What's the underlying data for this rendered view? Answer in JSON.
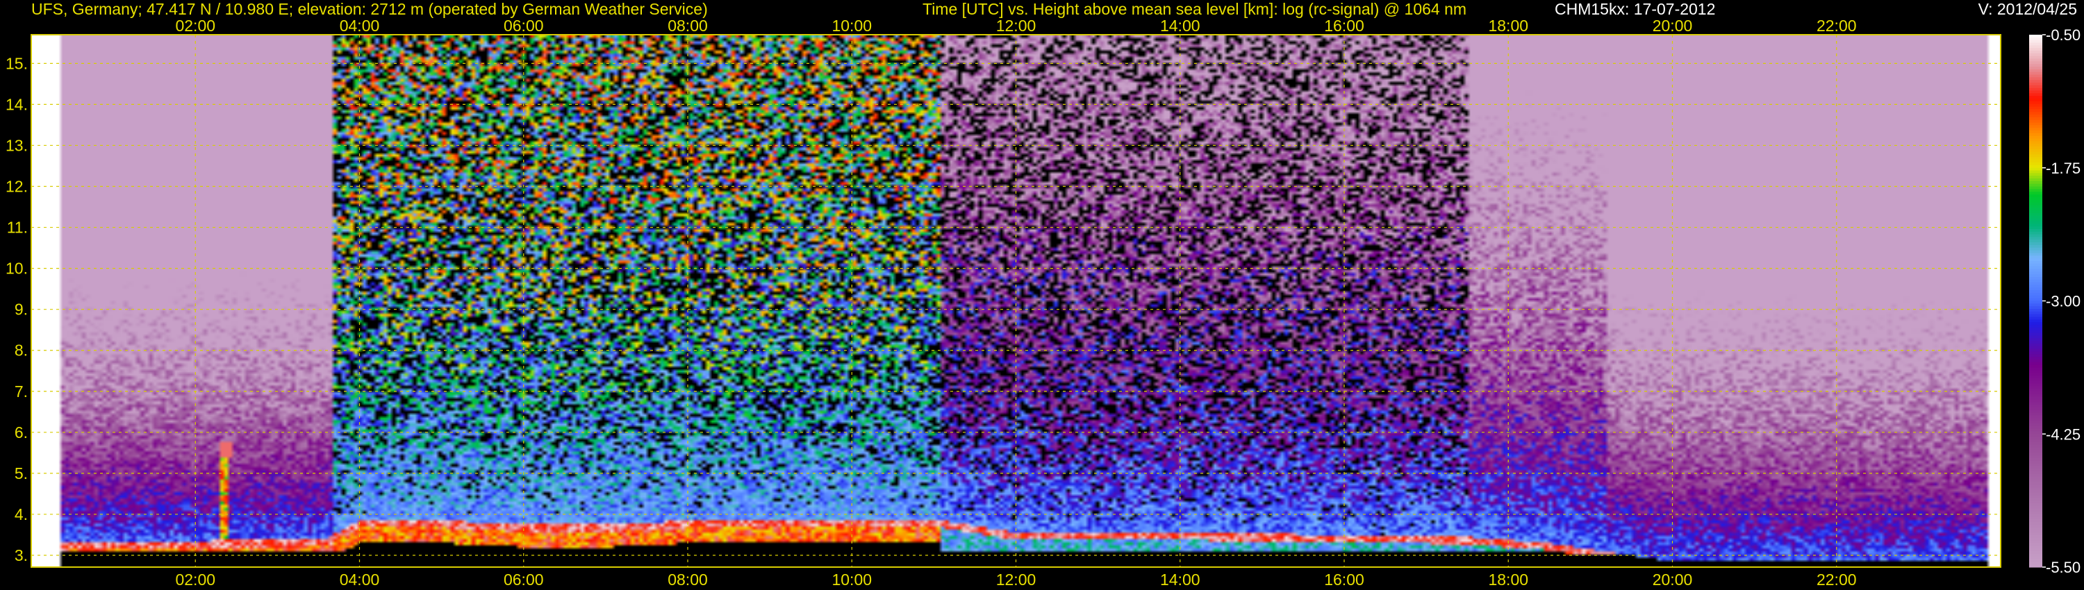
{
  "header": {
    "station": "UFS, Germany; 47.417 N / 10.980 E; elevation: 2712 m  (operated by German Weather Service)",
    "title": "Time [UTC] vs. Height above mean sea level [km]: log (rc-signal) @ 1064 nm",
    "instrument": "CHM15kx: 17-07-2012",
    "version": "V: 2012/04/25"
  },
  "colors": {
    "text": "#e8e000",
    "grid": "#d8cc00",
    "background": "#000000",
    "colorbar_text": "#ffffff"
  },
  "chart_data": {
    "type": "heatmap",
    "title": "Time [UTC] vs. Height above mean sea level [km]: log (rc-signal) @ 1064 nm",
    "xlabel": "Time [UTC]",
    "ylabel": "Height above mean sea level [km]",
    "x_range": [
      "00:00",
      "24:00"
    ],
    "ylim": [
      2.712,
      15.7
    ],
    "grid": true,
    "x_ticks": [
      "02:00",
      "04:00",
      "06:00",
      "08:00",
      "10:00",
      "12:00",
      "14:00",
      "16:00",
      "18:00",
      "20:00",
      "22:00"
    ],
    "x_tick_hours": [
      2,
      4,
      6,
      8,
      10,
      12,
      14,
      16,
      18,
      20,
      22
    ],
    "y_ticks": [
      3,
      4,
      5,
      6,
      7,
      8,
      9,
      10,
      11,
      12,
      13,
      14,
      15
    ],
    "y_tick_labels": [
      "3.",
      "4.",
      "5.",
      "6.",
      "7.",
      "8.",
      "9.",
      "10.",
      "11.",
      "12.",
      "13.",
      "14.",
      "15."
    ],
    "colorbar": {
      "ticks": [
        -0.5,
        -1.75,
        -3.0,
        -4.25,
        -5.5
      ],
      "tick_labels": [
        "-0.50",
        "-1.75",
        "-3.00",
        "-4.25",
        "-5.50"
      ],
      "range": [
        -5.5,
        -0.5
      ]
    },
    "features": {
      "boundary_layer_top_km": [
        [
          0,
          3.3
        ],
        [
          3.6,
          3.4
        ],
        [
          4,
          3.85
        ],
        [
          5,
          3.85
        ],
        [
          6,
          3.75
        ],
        [
          7,
          3.75
        ],
        [
          8,
          3.85
        ],
        [
          9,
          3.85
        ],
        [
          11.1,
          3.85
        ],
        [
          12,
          3.55
        ],
        [
          14,
          3.55
        ],
        [
          16,
          3.5
        ],
        [
          17.5,
          3.45
        ],
        [
          18.5,
          3.3
        ],
        [
          20,
          2.85
        ],
        [
          24,
          2.85
        ]
      ],
      "data_gap_hours": [
        [
          0,
          0.35
        ],
        [
          23.85,
          24
        ]
      ],
      "cloud_at_km": [
        [
          2.35,
          5.6
        ]
      ]
    }
  }
}
